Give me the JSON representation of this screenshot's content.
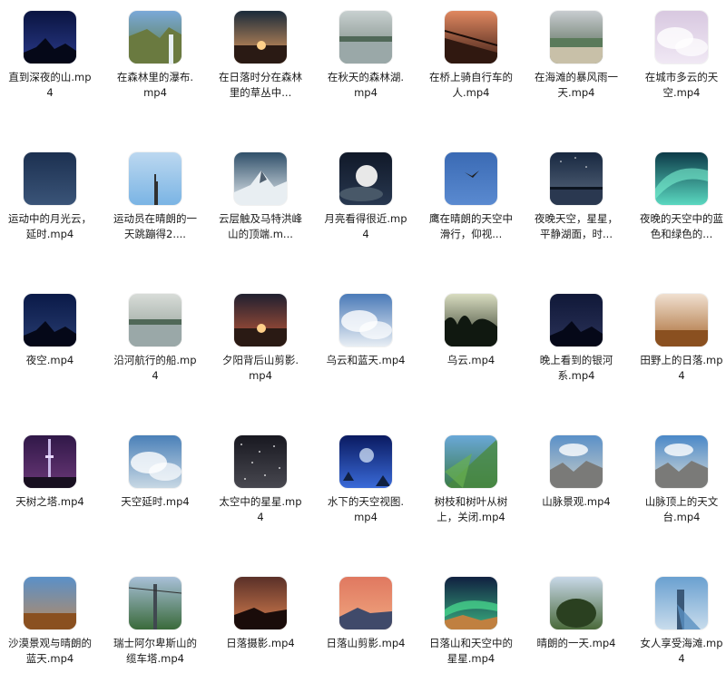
{
  "files": [
    {
      "label": "直到深夜的山.mp4",
      "icon": "night-mountain-thumbnail",
      "bg": [
        "#0a1440",
        "#2a3a8a"
      ],
      "scene": "mountain"
    },
    {
      "label": "在森林里的瀑布.mp4",
      "icon": "forest-waterfall-thumbnail",
      "bg": [
        "#7aa8d8",
        "#5a7a3a"
      ],
      "scene": "cliff"
    },
    {
      "label": "在日落时分在森林里的草丛中...",
      "icon": "sunset-grass-thumbnail",
      "bg": [
        "#1a2a3a",
        "#e8a060"
      ],
      "scene": "horizon"
    },
    {
      "label": "在秋天的森林湖.mp4",
      "icon": "autumn-lake-thumbnail",
      "bg": [
        "#c8d0d0",
        "#708078"
      ],
      "scene": "lake"
    },
    {
      "label": "在桥上骑自行车的人.mp4",
      "icon": "bridge-bicycle-thumbnail",
      "bg": [
        "#e08860",
        "#402018"
      ],
      "scene": "bridge"
    },
    {
      "label": "在海滩的暴风雨一天.mp4",
      "icon": "stormy-beach-thumbnail",
      "bg": [
        "#c8ccd0",
        "#4a6048"
      ],
      "scene": "beach"
    },
    {
      "label": "在城市多云的天空.mp4",
      "icon": "cloudy-city-sky-thumbnail",
      "bg": [
        "#d8c8e0",
        "#f0e8f4"
      ],
      "scene": "clouds"
    },
    {
      "label": "运动中的月光云，延时.mp4",
      "icon": "moonlight-clouds-thumbnail",
      "bg": [
        "#1c3050",
        "#3a5478"
      ],
      "scene": "plain"
    },
    {
      "label": "运动员在晴朗的一天跳蹦得2....",
      "icon": "athlete-sky-thumbnail",
      "bg": [
        "#bcd8f0",
        "#7ab4e4"
      ],
      "scene": "figure"
    },
    {
      "label": "云层触及马特洪峰山的顶端.m...",
      "icon": "matterhorn-thumbnail",
      "bg": [
        "#30506a",
        "#e8eef2"
      ],
      "scene": "peak"
    },
    {
      "label": "月亮看得很近.mp4",
      "icon": "moon-closeup-thumbnail",
      "bg": [
        "#101828",
        "#283850"
      ],
      "scene": "moon"
    },
    {
      "label": "鹰在晴朗的天空中滑行，仰视...",
      "icon": "eagle-sky-thumbnail",
      "bg": [
        "#3a6ab4",
        "#5a8ad0"
      ],
      "scene": "bird"
    },
    {
      "label": "夜晚天空，星星，平静湖面，时...",
      "icon": "night-lake-stars-thumbnail",
      "bg": [
        "#182840",
        "#5a6a80"
      ],
      "scene": "starlake"
    },
    {
      "label": "夜晚的天空中的蓝色和绿色的...",
      "icon": "aurora-thumbnail",
      "bg": [
        "#0c3a48",
        "#5ad8c0"
      ],
      "scene": "aurora"
    },
    {
      "label": "夜空.mp4",
      "icon": "night-sky-thumbnail",
      "bg": [
        "#0a1a48",
        "#283c70"
      ],
      "scene": "mountain"
    },
    {
      "label": "沿河航行的船.mp4",
      "icon": "river-boat-thumbnail",
      "bg": [
        "#d8dcd8",
        "#8a9890"
      ],
      "scene": "lake"
    },
    {
      "label": "夕阳背后山剪影.mp4",
      "icon": "sunset-mountain-silhouette-thumbnail",
      "bg": [
        "#202030",
        "#c05838"
      ],
      "scene": "horizon"
    },
    {
      "label": "乌云和蓝天.mp4",
      "icon": "clouds-blue-sky-thumbnail",
      "bg": [
        "#4a7ab8",
        "#e8eef4"
      ],
      "scene": "clouds"
    },
    {
      "label": "乌云.mp4",
      "icon": "dark-clouds-thumbnail",
      "bg": [
        "#d8dcc0",
        "#303828"
      ],
      "scene": "trees"
    },
    {
      "label": "晚上看到的银河系.mp4",
      "icon": "milky-way-thumbnail",
      "bg": [
        "#101838",
        "#2a3258"
      ],
      "scene": "mountain"
    },
    {
      "label": "田野上的日落.mp4",
      "icon": "field-sunset-thumbnail",
      "bg": [
        "#f0e0d0",
        "#a86830"
      ],
      "scene": "field"
    },
    {
      "label": "天树之塔.mp4",
      "icon": "skytree-tower-thumbnail",
      "bg": [
        "#301848",
        "#6a3878"
      ],
      "scene": "tower"
    },
    {
      "label": "天空延时.mp4",
      "icon": "sky-timelapse-thumbnail",
      "bg": [
        "#4a80b8",
        "#c8d8e4"
      ],
      "scene": "clouds"
    },
    {
      "label": "太空中的星星.mp4",
      "icon": "space-stars-thumbnail",
      "bg": [
        "#181820",
        "#484850"
      ],
      "scene": "stars"
    },
    {
      "label": "水下的天空视图.mp4",
      "icon": "underwater-sky-thumbnail",
      "bg": [
        "#0a1a60",
        "#3a6ad8"
      ],
      "scene": "underwater"
    },
    {
      "label": "树枝和树叶从树上，关闭.mp4",
      "icon": "tree-leaves-thumbnail",
      "bg": [
        "#6aa8d8",
        "#3a7a48"
      ],
      "scene": "leaves"
    },
    {
      "label": "山脉景观.mp4",
      "icon": "mountain-landscape-thumbnail",
      "bg": [
        "#5a90c8",
        "#c8ccc8"
      ],
      "scene": "range"
    },
    {
      "label": "山脉顶上的天文台.mp4",
      "icon": "mountain-observatory-thumbnail",
      "bg": [
        "#4a88c8",
        "#d8dcd8"
      ],
      "scene": "range"
    },
    {
      "label": "沙漠景观与晴朗的蓝天.mp4",
      "icon": "desert-blue-sky-thumbnail",
      "bg": [
        "#5a90c8",
        "#b88a60"
      ],
      "scene": "field"
    },
    {
      "label": "瑞士阿尔卑斯山的缆车塔.mp4",
      "icon": "cable-car-tower-thumbnail",
      "bg": [
        "#a8c0d8",
        "#3a6a3a"
      ],
      "scene": "cable"
    },
    {
      "label": "日落摄影.mp4",
      "icon": "sunset-photography-thumbnail",
      "bg": [
        "#5a3028",
        "#d88050"
      ],
      "scene": "peak2"
    },
    {
      "label": "日落山剪影.mp4",
      "icon": "sunset-mountain-thumbnail",
      "bg": [
        "#e07860",
        "#f0a880"
      ],
      "scene": "horizon2"
    },
    {
      "label": "日落山和天空中的星星.mp4",
      "icon": "sunset-stars-thumbnail",
      "bg": [
        "#102040",
        "#3ab080"
      ],
      "scene": "aurora2"
    },
    {
      "label": "晴朗的一天.mp4",
      "icon": "sunny-day-thumbnail",
      "bg": [
        "#c8d8e8",
        "#4a6a3a"
      ],
      "scene": "trees2"
    },
    {
      "label": "女人享受海滩.mp4",
      "icon": "woman-beach-thumbnail",
      "bg": [
        "#6aa0d0",
        "#c8dcec"
      ],
      "scene": "woman"
    }
  ]
}
